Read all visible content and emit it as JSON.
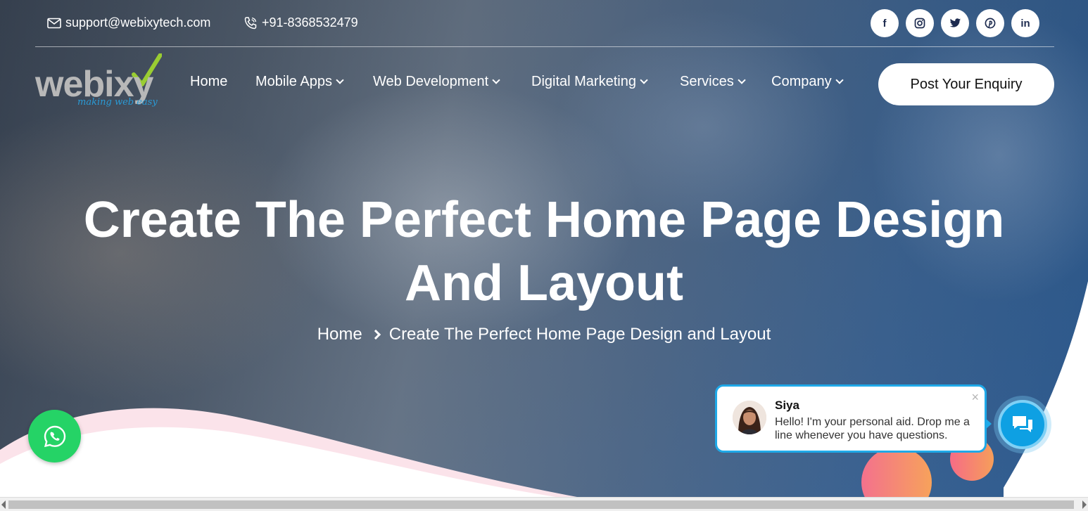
{
  "topbar": {
    "email": "support@webixytech.com",
    "phone": "+91-8368532479",
    "socials": [
      {
        "icon": "facebook-icon",
        "label": "f"
      },
      {
        "icon": "instagram-icon",
        "label": ""
      },
      {
        "icon": "twitter-icon",
        "label": ""
      },
      {
        "icon": "pinterest-icon",
        "label": ""
      },
      {
        "icon": "linkedin-icon",
        "label": "in"
      }
    ]
  },
  "logo": {
    "word": "webixy",
    "tagline": "making web easy"
  },
  "nav": {
    "items": [
      {
        "label": "Home",
        "dropdown": false
      },
      {
        "label": "Mobile Apps",
        "dropdown": true
      },
      {
        "label": "Web Development",
        "dropdown": true
      },
      {
        "label": "Digital Marketing",
        "dropdown": true
      },
      {
        "label": "Services",
        "dropdown": true
      },
      {
        "label": "Company",
        "dropdown": true
      }
    ],
    "cta": "Post Your Enquiry"
  },
  "hero": {
    "title_line1": "Create The Perfect Home Page Design",
    "title_line2": "And Layout",
    "breadcrumb": {
      "home": "Home",
      "current": "Create The Perfect Home Page Design and Layout"
    }
  },
  "chat": {
    "agent_name": "Siya",
    "message": "Hello! I'm your personal aid. Drop me a line whenever you have questions.",
    "close": "×"
  },
  "colors": {
    "accent_blue": "#1fa9e8",
    "whatsapp_green": "#25d366",
    "logo_green": "#9acd32",
    "orb_pink": "#f3718d",
    "orb_orange": "#f7a25b"
  }
}
